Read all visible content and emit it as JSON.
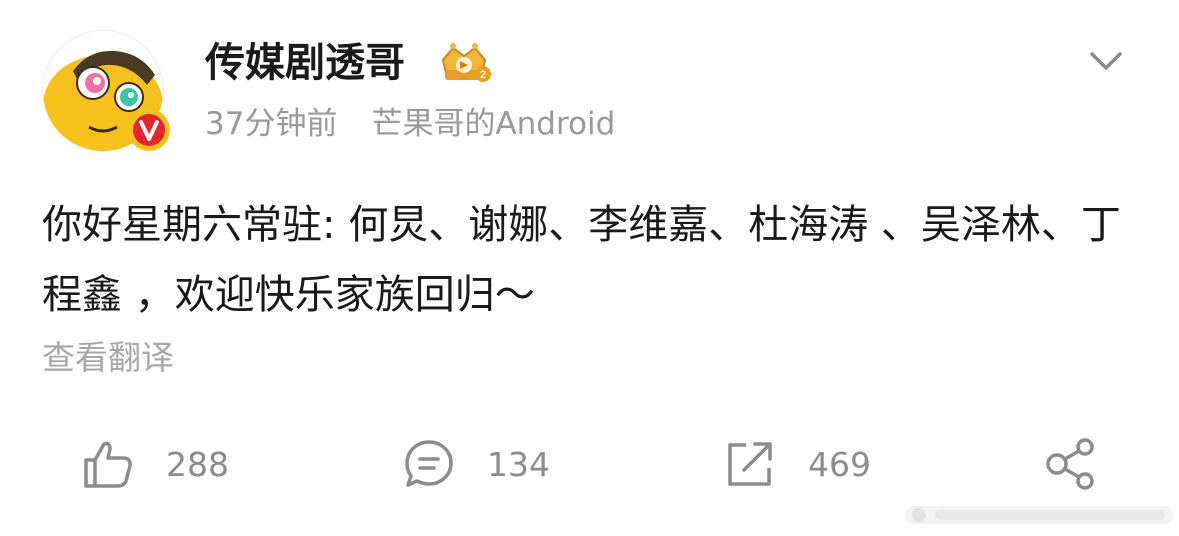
{
  "post": {
    "username": "传媒剧透哥",
    "time": "37分钟前",
    "source": "芒果哥的Android",
    "text": "你好星期六常驻: 何炅、谢娜、李维嘉、杜海涛 、吴泽林、丁程鑫 ，欢迎快乐家族回归～",
    "translate_label": "查看翻译"
  },
  "icons": {
    "avatar": "cartoon-avatar",
    "badge": "verified-v-badge",
    "crown": "crown-level-icon",
    "more": "chevron-down-icon",
    "like": "thumbs-up-icon",
    "comment": "comment-bubble-icon",
    "repost": "repost-arrow-icon",
    "share": "share-nodes-icon"
  },
  "actions": {
    "likes": "288",
    "comments": "134",
    "reposts": "469"
  },
  "colors": {
    "text": "#1a1a1a",
    "meta": "#9a9a9a",
    "icon": "#8c8c8c",
    "badge": "#e6262e",
    "badge_ring": "#f8c21a",
    "avatar_face": "#f6c11d"
  }
}
